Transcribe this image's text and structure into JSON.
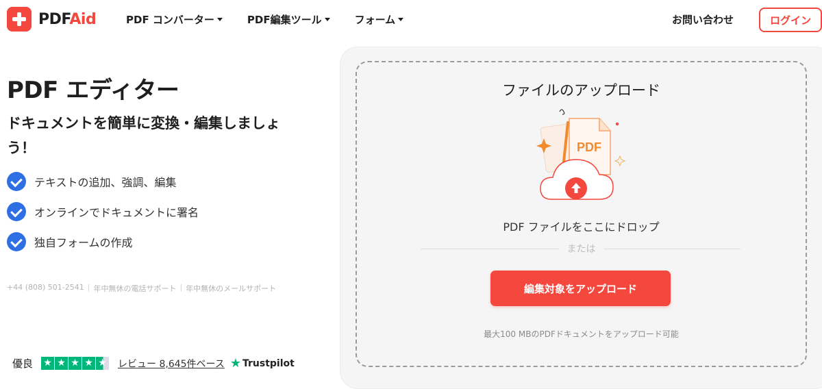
{
  "brand": {
    "name_part1": "PDF",
    "name_part2": "Aid",
    "accent_color": "#f4473d",
    "icon": "plus-icon"
  },
  "nav": {
    "items": [
      {
        "label": "PDF コンバーター"
      },
      {
        "label": "PDF編集ツール"
      },
      {
        "label": "フォーム"
      }
    ],
    "contact": "お問い合わせ",
    "login": "ログイン"
  },
  "hero": {
    "title": "PDF エディター",
    "subtitle": "ドキュメントを簡単に変換・編集しましょう！",
    "features": [
      {
        "label": "テキストの追加、強調、編集",
        "icon": "check-circle-icon"
      },
      {
        "label": "オンラインでドキュメントに署名",
        "icon": "check-circle-icon"
      },
      {
        "label": "独自フォームの作成",
        "icon": "check-circle-icon"
      }
    ],
    "check_color": "#2f6fe4"
  },
  "support": {
    "phone": "+44 (808) 501-2541",
    "phone_support": "年中無休の電話サポート",
    "mail_support": "年中無休のメールサポート"
  },
  "rating": {
    "word": "優良",
    "stars": 4.5,
    "reviews": "レビュー 8,645件ベース",
    "provider": "Trustpilot",
    "star_color": "#00b67a"
  },
  "upload": {
    "title": "ファイルのアップロード",
    "illustration_label": "PDF",
    "drop_text": "PDF ファイルをここにドロップ",
    "or_text": "または",
    "button_label": "編集対象をアップロード",
    "limit_text": "最大100 MBのPDFドキュメントをアップロード可能"
  }
}
